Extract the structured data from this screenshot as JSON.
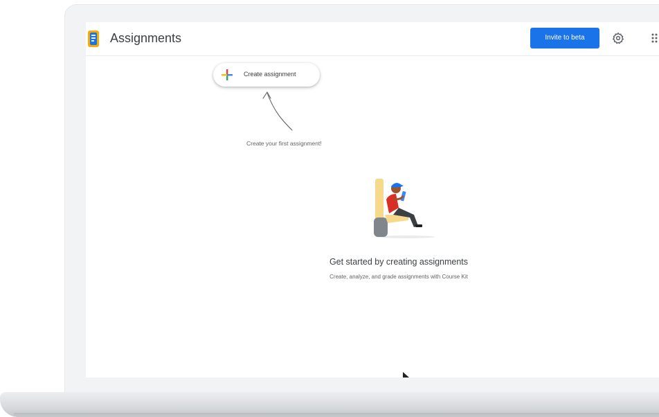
{
  "app": {
    "title": "Assignments",
    "icon": "course-kit-logo-icon"
  },
  "header": {
    "invite_label": "Invite to beta",
    "accent_color": "#1a73e8",
    "settings_icon": "gear-icon",
    "apps_icon": "apps-grid-icon"
  },
  "create": {
    "label": "Create assignment",
    "icon": "multicolor-plus-icon",
    "hint": "Create your first assignment!"
  },
  "empty_state": {
    "title": "Get started by creating assignments",
    "subtitle": "Create, analyze, and grade assignments with Course Kit",
    "illustration": "person-reading-tablet-in-chair"
  }
}
